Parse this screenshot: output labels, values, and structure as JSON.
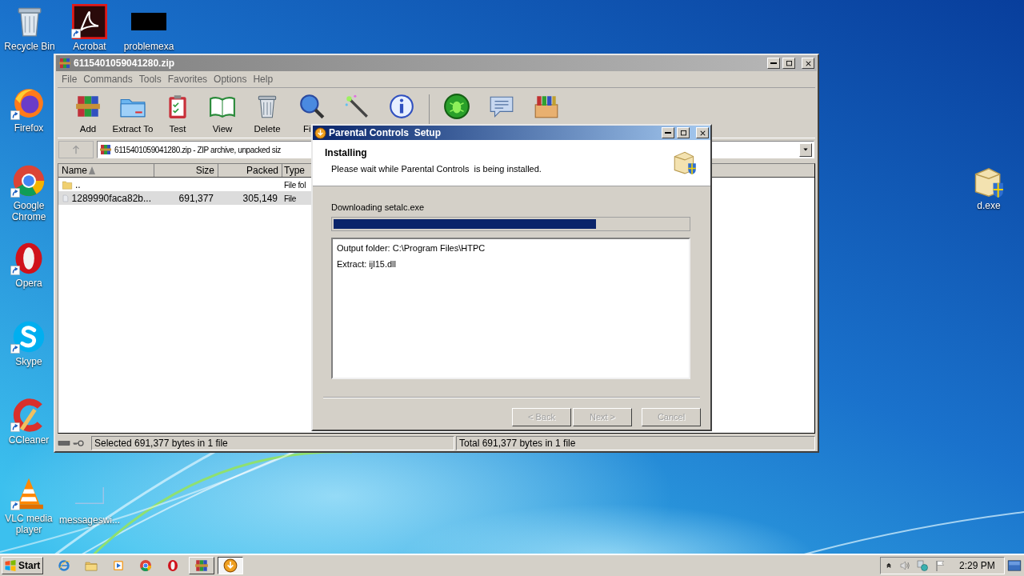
{
  "desktop_icons": [
    {
      "label": "Recycle Bin",
      "kind": "recycle-bin",
      "shortcut": false
    },
    {
      "label": "Acrobat",
      "kind": "acrobat",
      "shortcut": true
    },
    {
      "label": "problemexa",
      "kind": "dark-thumbnail",
      "shortcut": false
    },
    {
      "label": "Firefox",
      "kind": "firefox",
      "shortcut": true
    },
    {
      "label": "Google Chrome",
      "kind": "chrome",
      "shortcut": true
    },
    {
      "label": "Opera",
      "kind": "opera",
      "shortcut": true
    },
    {
      "label": "Skype",
      "kind": "skype",
      "shortcut": true
    },
    {
      "label": "CCleaner",
      "kind": "ccleaner",
      "shortcut": true
    },
    {
      "label": "VLC media player",
      "kind": "vlc",
      "shortcut": true
    },
    {
      "label": "messageswi...",
      "kind": "blank-file",
      "shortcut": false
    },
    {
      "label": "d.exe",
      "kind": "installer",
      "shortcut": false
    }
  ],
  "archive_window": {
    "title": "6115401059041280.zip",
    "menu": [
      "File",
      "Commands",
      "Tools",
      "Favorites",
      "Options",
      "Help"
    ],
    "toolbar": [
      {
        "label": "Add",
        "kind": "add"
      },
      {
        "label": "Extract To",
        "kind": "extract"
      },
      {
        "label": "Test",
        "kind": "test"
      },
      {
        "label": "View",
        "kind": "view"
      },
      {
        "label": "Delete",
        "kind": "delete"
      },
      {
        "label": "Fi",
        "kind": "find"
      },
      {
        "kind": "wizard"
      },
      {
        "kind": "info"
      },
      {
        "kind": "virus-scan"
      },
      {
        "kind": "comment"
      },
      {
        "kind": "sfx"
      }
    ],
    "address": "6115401059041280.zip - ZIP archive, unpacked siz",
    "columns": [
      {
        "label": "Name",
        "sorted": true
      },
      {
        "label": "Size",
        "sorted": false
      },
      {
        "label": "Packed",
        "sorted": false
      },
      {
        "label": "Type",
        "sorted": false
      }
    ],
    "rows": [
      {
        "name": "..",
        "type": "File fol",
        "kind": "folder",
        "selected": false
      },
      {
        "name": "1289990faca82b...",
        "size": "691,377",
        "packed": "305,149",
        "type": "File",
        "kind": "file",
        "selected": true
      }
    ],
    "status_left": "Selected 691,377 bytes in 1 file",
    "status_right": "Total 691,377 bytes in 1 file"
  },
  "setup_dialog": {
    "title": "Parental Controls  Setup",
    "heading": "Installing",
    "subheading": "Please wait while Parental Controls  is being installed.",
    "progress_label": "Downloading setalc.exe",
    "progress": {
      "level": 0.74
    },
    "log": [
      "Output folder: C:\\Program Files\\HTPC",
      "Extract: ijl15.dll"
    ],
    "buttons": [
      {
        "label": "< Back",
        "disabled": true
      },
      {
        "label": "Next >",
        "disabled": true
      },
      {
        "label": "Cancel",
        "disabled": true
      }
    ]
  },
  "taskbar": {
    "start": "Start",
    "quick_launch": [
      {
        "kind": "ie"
      },
      {
        "kind": "explorer"
      },
      {
        "kind": "media-player"
      },
      {
        "kind": "chrome"
      },
      {
        "kind": "opera"
      }
    ],
    "tasks": [
      {
        "kind": "archiver",
        "selected": false
      },
      {
        "kind": "installer",
        "selected": true
      }
    ],
    "tray": {
      "time": "2:29 PM"
    }
  }
}
